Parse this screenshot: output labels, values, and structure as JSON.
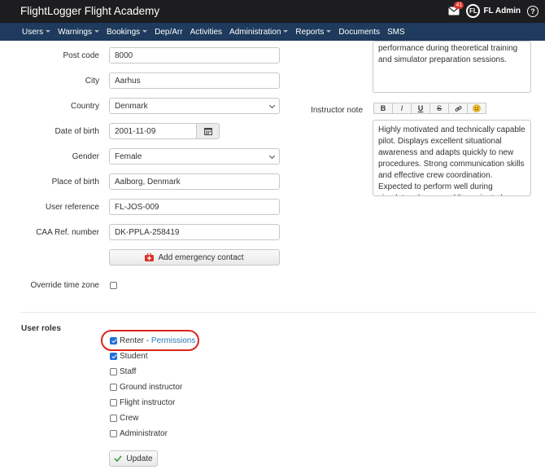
{
  "app": {
    "title": "FlightLogger Flight Academy",
    "notification_count": "41",
    "user": "FL Admin",
    "logo_text": "FL"
  },
  "nav": [
    {
      "label": "Users",
      "dropdown": true
    },
    {
      "label": "Warnings",
      "dropdown": true
    },
    {
      "label": "Bookings",
      "dropdown": true
    },
    {
      "label": "Dep/Arr",
      "dropdown": false
    },
    {
      "label": "Activities",
      "dropdown": false
    },
    {
      "label": "Administration",
      "dropdown": true
    },
    {
      "label": "Reports",
      "dropdown": true
    },
    {
      "label": "Documents",
      "dropdown": false
    },
    {
      "label": "SMS",
      "dropdown": false
    }
  ],
  "form": {
    "post_code": {
      "label": "Post code",
      "value": "8000"
    },
    "city": {
      "label": "City",
      "value": "Aarhus"
    },
    "country": {
      "label": "Country",
      "value": "Denmark"
    },
    "dob": {
      "label": "Date of birth",
      "value": "2001-11-09"
    },
    "gender": {
      "label": "Gender",
      "value": "Female"
    },
    "pob": {
      "label": "Place of birth",
      "value": "Aalborg, Denmark"
    },
    "user_ref": {
      "label": "User reference",
      "value": "FL-JOS-009"
    },
    "caa_ref": {
      "label": "CAA Ref. number",
      "value": "DK-PPLA-258419"
    },
    "emergency_button": "Add emergency contact",
    "override_tz": {
      "label": "Override time zone",
      "checked": false
    }
  },
  "notes": {
    "prev_text": "performance during theoretical training and simulator preparation sessions.",
    "instructor_label": "Instructor note",
    "toolbar": [
      "B",
      "I",
      "U",
      "S",
      "link",
      "emoji"
    ],
    "instructor_text": "Highly motivated and technically capable pilot. Displays excellent situational awareness and adapts quickly to new procedures. Strong communication skills and effective crew coordination. Expected to perform well during simulator phases and line-oriented training."
  },
  "roles": {
    "title": "User roles",
    "items": [
      {
        "label": "Renter",
        "checked": true,
        "link": "Permissions"
      },
      {
        "label": "Student",
        "checked": true
      },
      {
        "label": "Staff",
        "checked": false
      },
      {
        "label": "Ground instructor",
        "checked": false
      },
      {
        "label": "Flight instructor",
        "checked": false
      },
      {
        "label": "Crew",
        "checked": false
      },
      {
        "label": "Administrator",
        "checked": false
      }
    ]
  },
  "update_button": "Update",
  "colors": {
    "topbar": "#1d1d1f",
    "navbar": "#1e3a5c",
    "accent": "#1f6fd6",
    "highlight": "#d8261d",
    "emergency": "#d9342b",
    "update_check": "#3c9a3c"
  }
}
